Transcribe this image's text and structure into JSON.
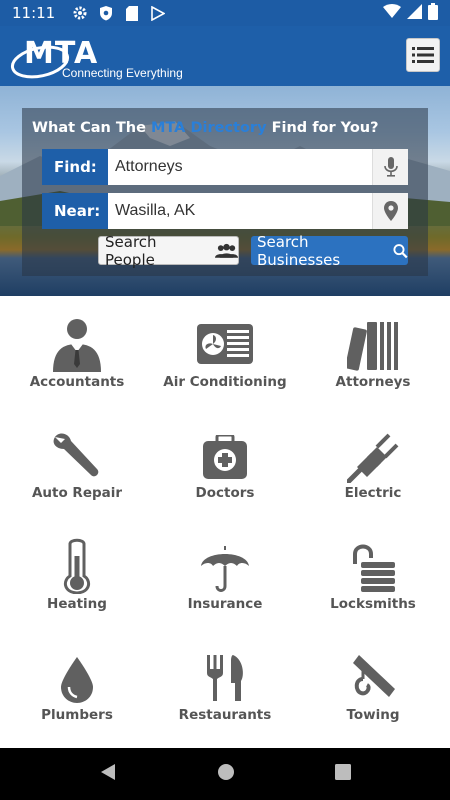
{
  "status_bar": {
    "time": "11:11"
  },
  "header": {
    "logo_text": "MTA",
    "tagline": "Connecting Everything"
  },
  "search": {
    "title_prefix": "What Can The ",
    "title_accent": "MTA Directory",
    "title_suffix": " Find for You?",
    "find_label": "Find:",
    "find_value": "Attorneys",
    "near_label": "Near:",
    "near_value": "Wasilla, AK",
    "search_people_label": "Search People",
    "search_businesses_label": "Search Businesses"
  },
  "categories": [
    {
      "label": "Accountants",
      "icon": "accountant-icon"
    },
    {
      "label": "Air Conditioning",
      "icon": "air-conditioner-icon"
    },
    {
      "label": "Attorneys",
      "icon": "law-books-icon"
    },
    {
      "label": "Auto Repair",
      "icon": "wrench-icon"
    },
    {
      "label": "Doctors",
      "icon": "medical-kit-icon"
    },
    {
      "label": "Electric",
      "icon": "plug-icon"
    },
    {
      "label": "Heating",
      "icon": "thermometer-icon"
    },
    {
      "label": "Insurance",
      "icon": "umbrella-icon"
    },
    {
      "label": "Locksmiths",
      "icon": "padlock-icon"
    },
    {
      "label": "Plumbers",
      "icon": "water-drop-icon"
    },
    {
      "label": "Restaurants",
      "icon": "fork-knife-icon"
    },
    {
      "label": "Towing",
      "icon": "tow-hook-icon"
    }
  ],
  "colors": {
    "brand_blue": "#1e5fa9",
    "accent_blue": "#2c72c0",
    "icon_gray": "#606060"
  }
}
